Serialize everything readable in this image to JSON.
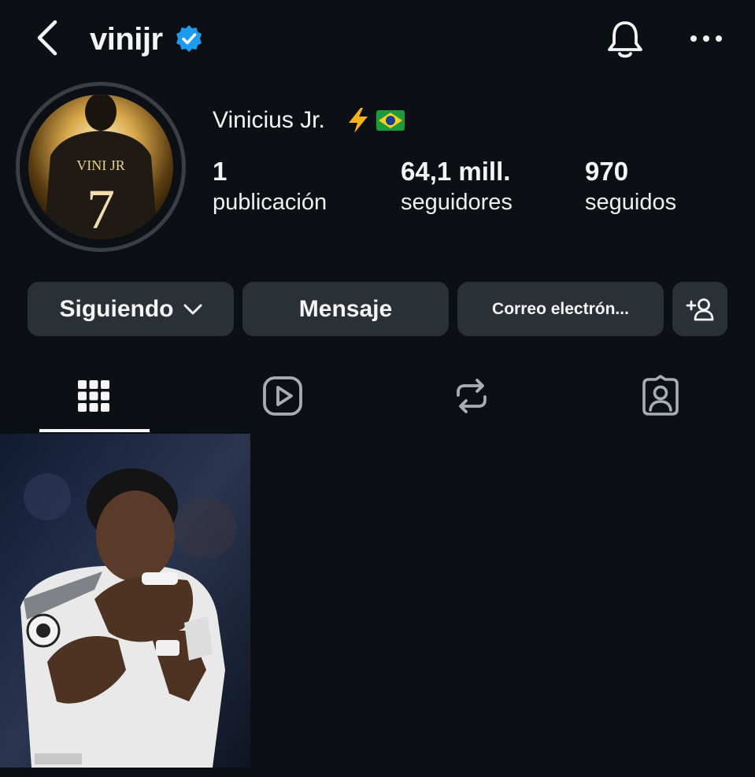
{
  "header": {
    "username": "vinijr",
    "back_icon": "chevron-left-icon",
    "verified_icon": "verified-badge-icon",
    "notifications_icon": "bell-icon",
    "more_icon": "more-horizontal-icon"
  },
  "profile": {
    "full_name": "Vinicius Jr.",
    "name_emojis": [
      "lightning-icon",
      "brazil-flag-icon"
    ],
    "avatar_caption": "VINI JR",
    "avatar_number": "7",
    "stats": [
      {
        "value": "1",
        "label": "publicación"
      },
      {
        "value": "64,1 mill.",
        "label": "seguidores"
      },
      {
        "value": "970",
        "label": "seguidos"
      }
    ]
  },
  "actions": {
    "following_label": "Siguiendo",
    "message_label": "Mensaje",
    "email_label": "Correo electrón...",
    "add_user_icon": "add-user-icon"
  },
  "tabs": [
    {
      "icon": "grid-icon",
      "active": true
    },
    {
      "icon": "reels-icon",
      "active": false
    },
    {
      "icon": "reposts-icon",
      "active": false
    },
    {
      "icon": "tagged-icon",
      "active": false
    }
  ],
  "colors": {
    "background": "#0c1014",
    "button": "#2b3036",
    "verified": "#1d9bf0",
    "text": "#f5f5f5"
  }
}
